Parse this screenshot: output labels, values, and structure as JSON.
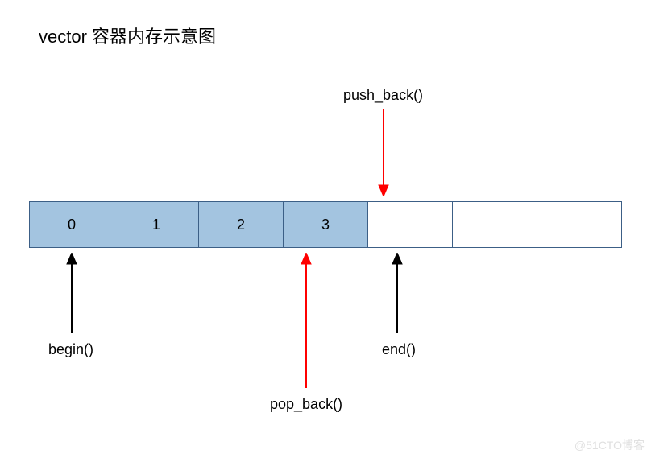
{
  "title": "vector 容器内存示意图",
  "cells": [
    {
      "value": "0",
      "filled": true
    },
    {
      "value": "1",
      "filled": true
    },
    {
      "value": "2",
      "filled": true
    },
    {
      "value": "3",
      "filled": true
    },
    {
      "value": "",
      "filled": false
    },
    {
      "value": "",
      "filled": false
    },
    {
      "value": "",
      "filled": false
    }
  ],
  "labels": {
    "push_back": "push_back()",
    "pop_back": "pop_back()",
    "begin": "begin()",
    "end": "end()"
  },
  "watermark": "@51CTO博客"
}
